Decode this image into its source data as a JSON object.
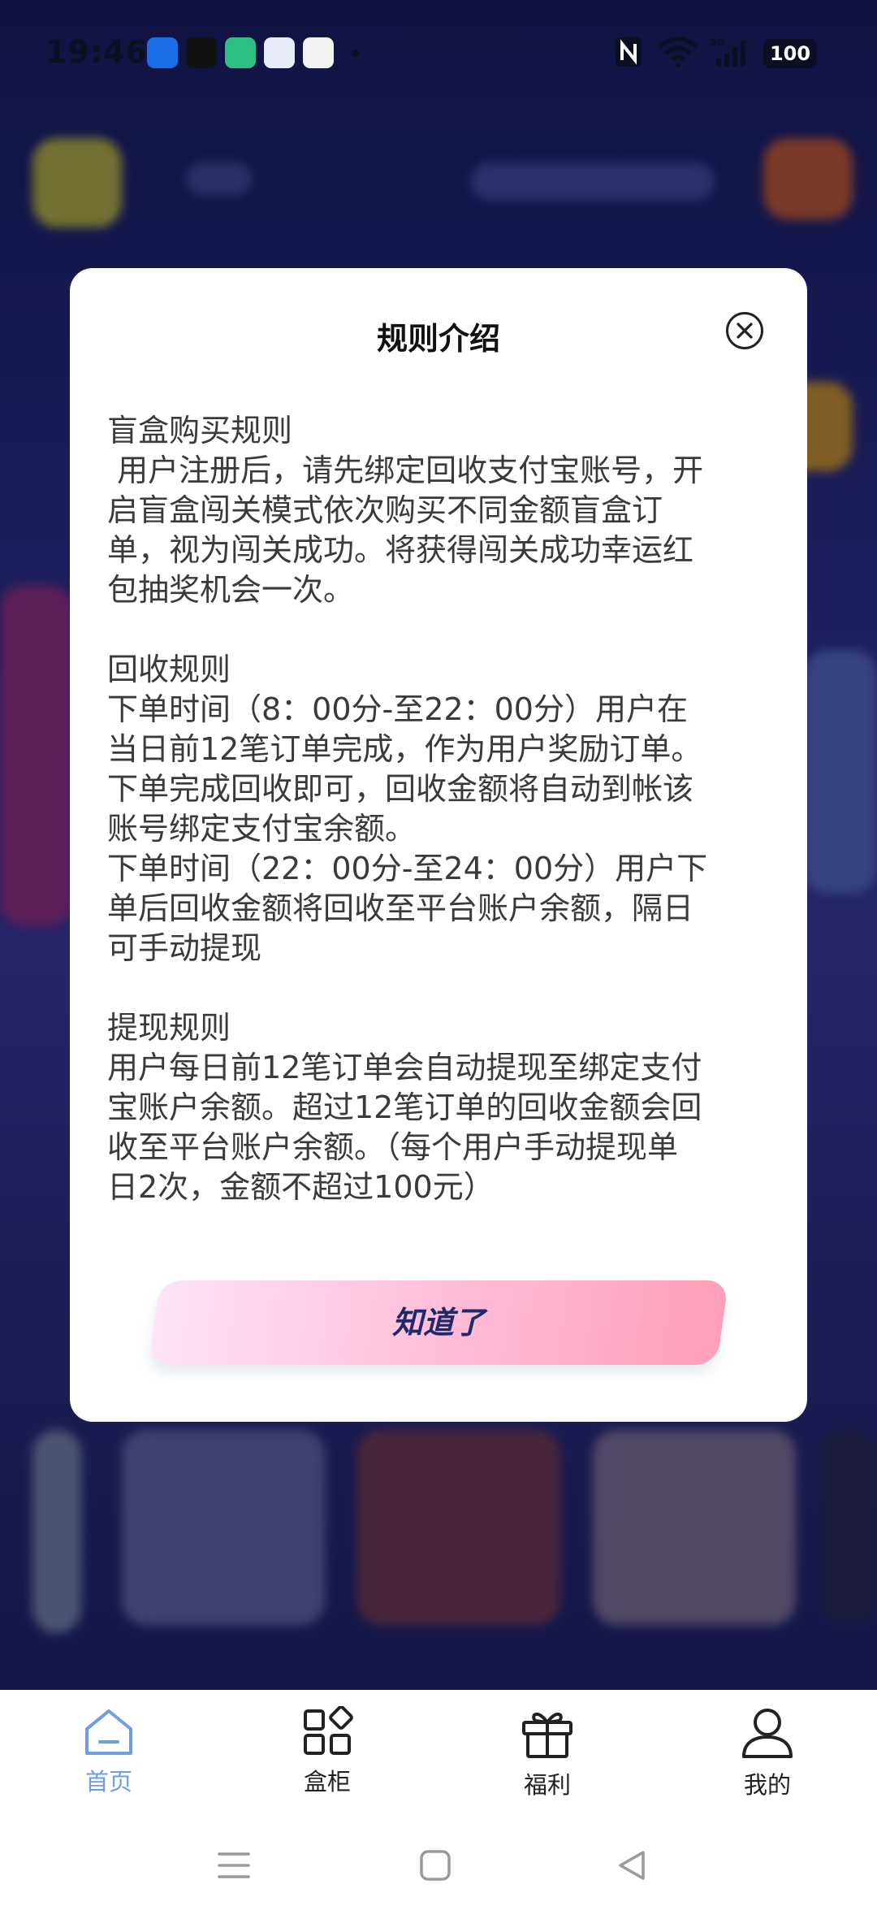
{
  "status_bar": {
    "time": "19:46",
    "battery": "100",
    "network": "5G",
    "icons": [
      "pinwheel-app-icon",
      "tiktok-icon",
      "battery-app-icon",
      "message-app-icon",
      "qq-icon",
      "nfc-icon",
      "wifi-icon",
      "signal-icon"
    ]
  },
  "modal": {
    "title": "规则介绍",
    "sections": [
      {
        "lines": [
          "盲盒购买规则",
          " 用户注册后，请先绑定回收支付宝账号，开",
          "启盲盒闯关模式依次购买不同金额盲盒订",
          "单，视为闯关成功。将获得闯关成功幸运红",
          "包抽奖机会一次。"
        ]
      },
      {
        "lines": [
          "回收规则",
          "下单时间（8：00分-至22：00分）用户在",
          "当日前12笔订单完成，作为用户奖励订单。",
          "下单完成回收即可，回收金额将自动到帐该",
          "账号绑定支付宝余额。",
          "下单时间（22：00分-至24：00分）用户下",
          "单后回收金额将回收至平台账户余额，隔日",
          "可手动提现"
        ]
      },
      {
        "lines": [
          "提现规则",
          "用户每日前12笔订单会自动提现至绑定支付",
          "宝账户余额。超过12笔订单的回收金额会回",
          "收至平台账户余额。（每个用户手动提现单",
          "日2次，金额不超过100元）"
        ]
      }
    ],
    "confirm_label": "知道了"
  },
  "bottom_nav": {
    "items": [
      {
        "label": "首页",
        "icon": "home-icon",
        "active": true
      },
      {
        "label": "盒柜",
        "icon": "grid-icon",
        "active": false
      },
      {
        "label": "福利",
        "icon": "gift-icon",
        "active": false
      },
      {
        "label": "我的",
        "icon": "user-icon",
        "active": false
      }
    ]
  },
  "colors": {
    "active_nav": "#6f9ee0",
    "button_gradient_start": "#ffe3f7",
    "button_gradient_end": "#ff9fb9",
    "button_text": "#1f2a6b"
  }
}
